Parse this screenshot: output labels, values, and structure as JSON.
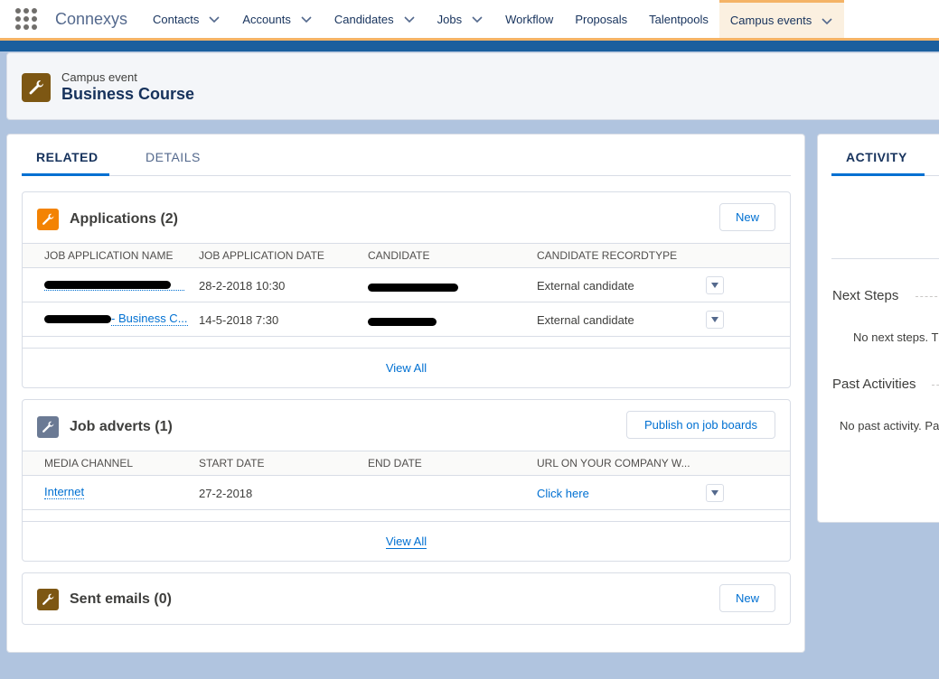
{
  "app": {
    "name": "Connexys",
    "nav": [
      {
        "label": "Contacts",
        "has_menu": true
      },
      {
        "label": "Accounts",
        "has_menu": true
      },
      {
        "label": "Candidates",
        "has_menu": true
      },
      {
        "label": "Jobs",
        "has_menu": true
      },
      {
        "label": "Workflow",
        "has_menu": false
      },
      {
        "label": "Proposals",
        "has_menu": false
      },
      {
        "label": "Talentpools",
        "has_menu": false
      },
      {
        "label": "Campus events",
        "has_menu": true,
        "active": true
      }
    ]
  },
  "record": {
    "type": "Campus event",
    "name": "Business Course"
  },
  "tabs": {
    "related": "RELATED",
    "details": "DETAILS"
  },
  "applications": {
    "title": "Applications (2)",
    "new_label": "New",
    "columns": [
      "JOB APPLICATION NAME",
      "JOB APPLICATION DATE",
      "CANDIDATE",
      "CANDIDATE RECORDTYPE"
    ],
    "rows": [
      {
        "name_visible": "",
        "date": "28-2-2018 10:30",
        "recordtype": "External candidate"
      },
      {
        "name_visible": "- Business C...",
        "date": "14-5-2018 7:30",
        "recordtype": "External candidate"
      }
    ],
    "view_all": "View All"
  },
  "job_adverts": {
    "title": "Job adverts (1)",
    "publish_label": "Publish on job boards",
    "columns": [
      "MEDIA CHANNEL",
      "START DATE",
      "END DATE",
      "URL ON YOUR COMPANY W..."
    ],
    "rows": [
      {
        "channel": "Internet",
        "start": "27-2-2018",
        "end": "",
        "url": "Click here"
      }
    ],
    "view_all": "View All"
  },
  "sent_emails": {
    "title": "Sent emails (0)",
    "new_label": "New"
  },
  "activity": {
    "tab": "ACTIVITY",
    "next_steps": "Next Steps",
    "no_next": "No next steps. T",
    "past": "Past Activities",
    "no_past": "No past activity. Pa"
  },
  "colors": {
    "accent": "#0070d2",
    "nav_active": "#f4b366",
    "record_icon": "#7d5713",
    "applications_icon": "#f38303",
    "job_adverts_icon": "#6b7a94"
  }
}
